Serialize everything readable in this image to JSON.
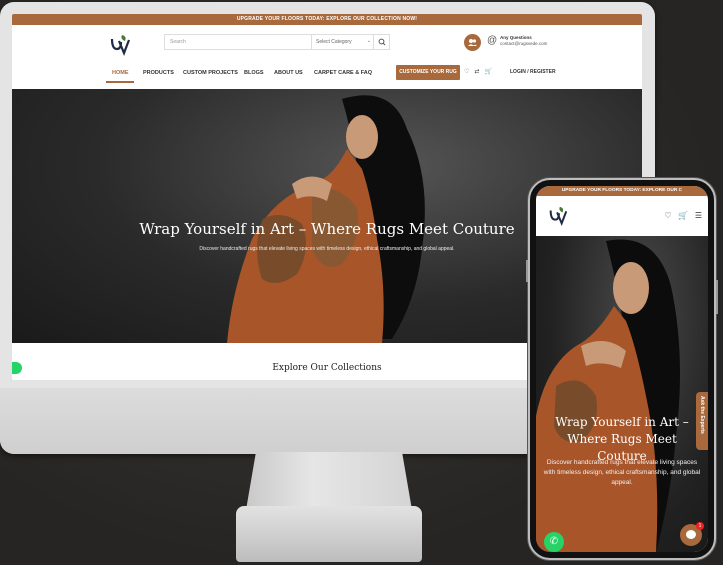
{
  "desktop": {
    "topbar_text": "UPGRADE YOUR FLOORS TODAY: EXPLORE OUR COLLECTION NOW!",
    "search": {
      "placeholder": "Search",
      "category": "Select Category"
    },
    "contact": {
      "title": "Any Questions",
      "email": "contact@rugsvede.com"
    },
    "nav": {
      "items": [
        "HOME",
        "PRODUCTS",
        "CUSTOM PROJECTS",
        "BLOGS",
        "ABOUT US",
        "CARPET CARE & FAQ"
      ],
      "cta": "CUSTOMIZE YOUR RUG",
      "login": "LOGIN / REGISTER"
    },
    "hero": {
      "title": "Wrap Yourself in Art – Where Rugs Meet Couture",
      "subtitle": "Discover handcrafted rugs that elevate living spaces with timeless design, ethical craftsmanship, and global appeal."
    },
    "collections_heading": "Explore Our Collections"
  },
  "mobile": {
    "topbar_text": "UPGRADE YOUR FLOORS TODAY: EXPLORE OUR C",
    "hero": {
      "title": "Wrap Yourself in Art – Where Rugs Meet Couture",
      "subtitle": "Discover handcrafted rugs that elevate living spaces with timeless design, ethical craftsmanship, and global appeal."
    },
    "ask_tab": "Ask the Experts",
    "chat_badge": "1"
  },
  "colors": {
    "brand": "#a8693c",
    "whatsapp": "#25d366"
  },
  "icons": [
    "uv-logo",
    "search-icon",
    "users-icon",
    "at-icon",
    "heart-icon",
    "compare-icon",
    "cart-icon",
    "menu-icon",
    "whatsapp-icon",
    "chat-icon"
  ]
}
